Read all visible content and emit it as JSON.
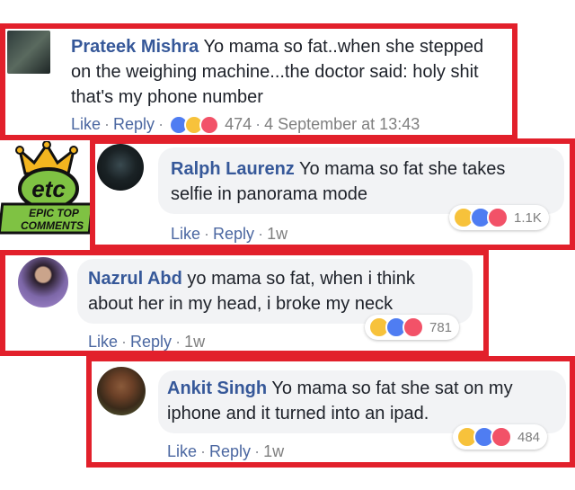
{
  "comments": [
    {
      "author": "Prateek Mishra",
      "text_lines": [
        "Yo mama so fat..when she stepped",
        "on the weighing machine...the doctor said: holy shit",
        "that's my phone number"
      ],
      "like": "Like",
      "reply": "Reply",
      "reaction_count": "474",
      "time": "4 September at 13:43"
    },
    {
      "author": "Ralph Laurenz",
      "text_lines": [
        "Yo mama so fat she takes",
        "selfie in panorama mode"
      ],
      "like": "Like",
      "reply": "Reply",
      "time": "1w",
      "reaction_count": "1.1K"
    },
    {
      "author": "Nazrul Abd",
      "text_lines": [
        "yo mama so fat, when i think",
        "about her in my head, i broke my neck"
      ],
      "like": "Like",
      "reply": "Reply",
      "time": "1w",
      "reaction_count": "781"
    },
    {
      "author": "Ankit Singh",
      "text_lines": [
        "Yo mama so fat she sat on my",
        "iphone and it turned into an ipad."
      ],
      "like": "Like",
      "reply": "Reply",
      "time": "1w",
      "reaction_count": "484"
    }
  ],
  "logo": {
    "letters": "etc",
    "line1": "EPIC TOP",
    "line2": "COMMENTS",
    "colors": {
      "green": "#7fc243",
      "gold": "#f3b51f",
      "black": "#111111"
    }
  },
  "colors": {
    "frame": "#e2202b",
    "author": "#365899",
    "link": "#4b67a1",
    "bubble": "#f2f3f5"
  }
}
